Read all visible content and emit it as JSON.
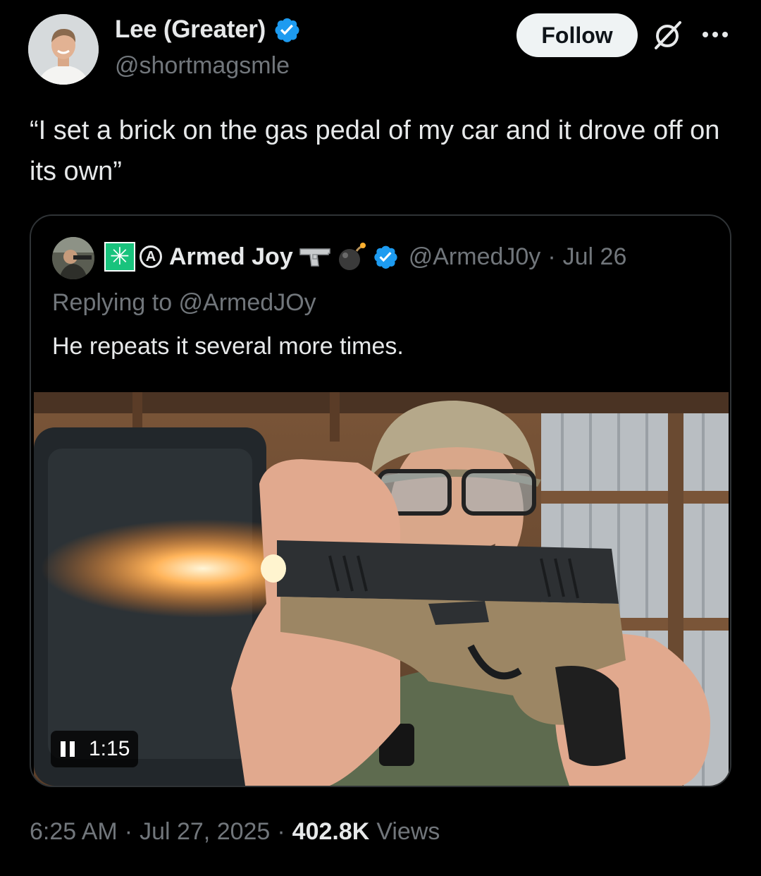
{
  "author": {
    "display_name": "Lee (Greater)",
    "handle": "@shortmagsmle",
    "verified": true
  },
  "header": {
    "follow_label": "Follow",
    "icons": [
      "grok-icon",
      "more-icon"
    ]
  },
  "tweet": {
    "text": "“I set a brick on the gas pedal of my car and it drove off on its own”"
  },
  "quote": {
    "badge_glyph": "✳",
    "circle_a_glyph": "A",
    "display_name": "Armed Joy",
    "handle": "@ArmedJ0y",
    "separator": "·",
    "date": "Jul 26",
    "replying_to": "Replying to @ArmedJOy",
    "text": "He repeats it several more times.",
    "video": {
      "duration": "1:15",
      "state": "playing"
    }
  },
  "footer": {
    "time": "6:25 AM",
    "sep1": "·",
    "date": "Jul 27, 2025",
    "sep2": "·",
    "views_count": "402.8K",
    "views_label": "Views"
  },
  "colors": {
    "background": "#000000",
    "text_primary": "#e7e9ea",
    "text_secondary": "#71767b",
    "verified_blue": "#1d9bf0",
    "follow_button_bg": "#eff3f4",
    "border": "#2f3336"
  }
}
